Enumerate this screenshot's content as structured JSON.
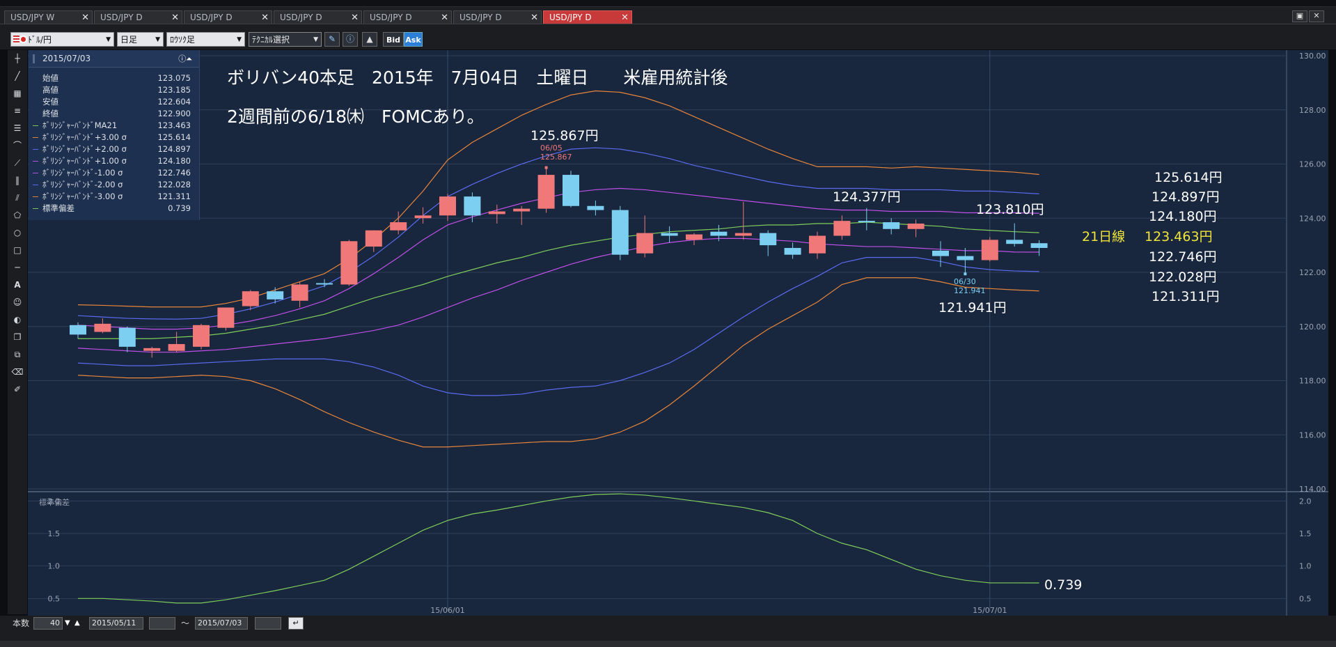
{
  "tabs": [
    {
      "label": "USD/JPY W",
      "active": false
    },
    {
      "label": "USD/JPY D",
      "active": false
    },
    {
      "label": "USD/JPY D",
      "active": false
    },
    {
      "label": "USD/JPY D",
      "active": false
    },
    {
      "label": "USD/JPY D",
      "active": false
    },
    {
      "label": "USD/JPY D",
      "active": false
    },
    {
      "label": "USD/JPY D",
      "active": true
    }
  ],
  "tab_close": "✕",
  "toolbar": {
    "symbol": "ﾄﾞﾙ/円",
    "period": "日足",
    "chart_type": "ﾛｳｿｸ足",
    "technical": "ﾃｸﾆｶﾙ選択",
    "bid": "Bid",
    "ask": "Ask"
  },
  "ohlc_panel": {
    "date": "2015/07/03",
    "rows": [
      {
        "label": "始値",
        "value": "123.075",
        "color": ""
      },
      {
        "label": "高値",
        "value": "123.185",
        "color": ""
      },
      {
        "label": "安値",
        "value": "122.604",
        "color": ""
      },
      {
        "label": "終値",
        "value": "122.900",
        "color": ""
      },
      {
        "label": "ﾎﾞﾘﾝｼﾞｬｰﾊﾞﾝﾄﾞMA21",
        "value": "123.463",
        "color": "#7fcf5a"
      },
      {
        "label": "ﾎﾞﾘﾝｼﾞｬｰﾊﾞﾝﾄﾞ+3.00 σ",
        "value": "125.614",
        "color": "#e8863a"
      },
      {
        "label": "ﾎﾞﾘﾝｼﾞｬｰﾊﾞﾝﾄﾞ+2.00 σ",
        "value": "124.897",
        "color": "#5a6cf0"
      },
      {
        "label": "ﾎﾞﾘﾝｼﾞｬｰﾊﾞﾝﾄﾞ+1.00 σ",
        "value": "124.180",
        "color": "#c050e8"
      },
      {
        "label": "ﾎﾞﾘﾝｼﾞｬｰﾊﾞﾝﾄﾞ-1.00 σ",
        "value": "122.746",
        "color": "#c050e8"
      },
      {
        "label": "ﾎﾞﾘﾝｼﾞｬｰﾊﾞﾝﾄﾞ-2.00 σ",
        "value": "122.028",
        "color": "#5a6cf0"
      },
      {
        "label": "ﾎﾞﾘﾝｼﾞｬｰﾊﾞﾝﾄﾞ-3.00 σ",
        "value": "121.311",
        "color": "#e8863a"
      },
      {
        "label": "標準偏差",
        "value": "0.739",
        "color": "#7fcf5a"
      }
    ]
  },
  "annotations": {
    "title_line1": "ボリバン40本足　2015年　7月04日　土曜日　　米雇用統計後",
    "title_line2": "2週間前の6/18㈭　FOMCあり。",
    "high_label": "125.867円",
    "high_marker_date": "06/05",
    "high_marker_value": "125.867",
    "mid_label": "124.377円",
    "right_label": "123.810円",
    "low_label": "121.941円",
    "low_marker_date": "06/30",
    "low_marker_value": "121.941",
    "band_p3": "125.614円",
    "band_p2": "124.897円",
    "band_p1": "124.180円",
    "ma21_prefix": "21日線",
    "ma21_value": "123.463円",
    "band_m1": "122.746円",
    "band_m2": "122.028円",
    "band_m3": "121.311円",
    "sd_value": "0.739"
  },
  "bottom": {
    "count_label": "本数",
    "count_value": "40",
    "from_date": "2015/05/11",
    "tilde": "～",
    "to_date": "2015/07/03"
  },
  "colors": {
    "bull": "#f07878",
    "bear": "#7ccff0",
    "ma21": "#7fcf5a",
    "sigma1": "#c050e8",
    "sigma2": "#5a6cf0",
    "sigma3": "#e8863a",
    "ma21_label": "#f2e53a"
  },
  "chart_data": [
    {
      "type": "candlestick",
      "title": "",
      "xlabel": "",
      "ylabel": "",
      "ylim": [
        114.0,
        130.0
      ],
      "y_ticks": [
        "130.00",
        "128.00",
        "126.00",
        "124.00",
        "122.00",
        "120.00",
        "118.00",
        "116.00",
        "114.00"
      ],
      "x_ticks": [
        {
          "label": "15/06/01",
          "index": 15
        },
        {
          "label": "15/07/01",
          "index": 37
        }
      ],
      "grid": true,
      "candles": [
        {
          "o": 120.05,
          "h": 120.15,
          "l": 119.55,
          "c": 119.7
        },
        {
          "o": 119.8,
          "h": 120.3,
          "l": 119.75,
          "c": 120.1
        },
        {
          "o": 119.95,
          "h": 120.0,
          "l": 119.05,
          "c": 119.25
        },
        {
          "o": 119.1,
          "h": 119.25,
          "l": 118.85,
          "c": 119.2
        },
        {
          "o": 119.1,
          "h": 119.8,
          "l": 119.05,
          "c": 119.35
        },
        {
          "o": 119.25,
          "h": 120.1,
          "l": 119.15,
          "c": 120.05
        },
        {
          "o": 119.95,
          "h": 120.7,
          "l": 119.85,
          "c": 120.7
        },
        {
          "o": 120.75,
          "h": 121.35,
          "l": 120.6,
          "c": 121.3
        },
        {
          "o": 121.3,
          "h": 121.45,
          "l": 120.85,
          "c": 121.0
        },
        {
          "o": 120.95,
          "h": 121.65,
          "l": 120.7,
          "c": 121.55
        },
        {
          "o": 121.6,
          "h": 121.75,
          "l": 121.45,
          "c": 121.55
        },
        {
          "o": 121.55,
          "h": 123.2,
          "l": 121.5,
          "c": 123.15
        },
        {
          "o": 122.95,
          "h": 123.55,
          "l": 122.75,
          "c": 123.55
        },
        {
          "o": 123.55,
          "h": 124.25,
          "l": 123.4,
          "c": 123.85
        },
        {
          "o": 124.0,
          "h": 124.4,
          "l": 123.8,
          "c": 124.1
        },
        {
          "o": 124.1,
          "h": 124.9,
          "l": 123.9,
          "c": 124.8
        },
        {
          "o": 124.8,
          "h": 124.95,
          "l": 123.85,
          "c": 124.1
        },
        {
          "o": 124.15,
          "h": 124.5,
          "l": 123.8,
          "c": 124.25
        },
        {
          "o": 124.25,
          "h": 124.45,
          "l": 123.75,
          "c": 124.35
        },
        {
          "o": 124.35,
          "h": 125.867,
          "l": 124.2,
          "c": 125.6
        },
        {
          "o": 125.6,
          "h": 125.75,
          "l": 124.4,
          "c": 124.45
        },
        {
          "o": 124.45,
          "h": 124.65,
          "l": 124.1,
          "c": 124.3
        },
        {
          "o": 124.3,
          "h": 124.45,
          "l": 122.45,
          "c": 122.65
        },
        {
          "o": 122.7,
          "h": 124.1,
          "l": 122.55,
          "c": 123.45
        },
        {
          "o": 123.45,
          "h": 123.7,
          "l": 123.1,
          "c": 123.35
        },
        {
          "o": 123.2,
          "h": 123.45,
          "l": 123.0,
          "c": 123.4
        },
        {
          "o": 123.5,
          "h": 123.75,
          "l": 123.15,
          "c": 123.35
        },
        {
          "o": 123.35,
          "h": 124.6,
          "l": 123.2,
          "c": 123.45
        },
        {
          "o": 123.45,
          "h": 123.55,
          "l": 122.6,
          "c": 123.0
        },
        {
          "o": 122.9,
          "h": 123.1,
          "l": 122.5,
          "c": 122.65
        },
        {
          "o": 122.7,
          "h": 123.5,
          "l": 122.5,
          "c": 123.35
        },
        {
          "o": 123.35,
          "h": 124.1,
          "l": 123.2,
          "c": 123.9
        },
        {
          "o": 123.9,
          "h": 124.377,
          "l": 123.55,
          "c": 123.85
        },
        {
          "o": 123.85,
          "h": 124.0,
          "l": 123.4,
          "c": 123.6
        },
        {
          "o": 123.6,
          "h": 123.95,
          "l": 123.3,
          "c": 123.8
        },
        {
          "o": 122.8,
          "h": 123.15,
          "l": 122.2,
          "c": 122.6
        },
        {
          "o": 122.6,
          "h": 122.9,
          "l": 121.941,
          "c": 122.45
        },
        {
          "o": 122.45,
          "h": 123.3,
          "l": 122.4,
          "c": 123.2
        },
        {
          "o": 123.2,
          "h": 123.81,
          "l": 122.95,
          "c": 123.05
        },
        {
          "o": 123.075,
          "h": 123.185,
          "l": 122.604,
          "c": 122.9
        }
      ],
      "bands": {
        "plus3": [
          120.8,
          120.78,
          120.75,
          120.72,
          120.72,
          120.72,
          120.85,
          121.05,
          121.35,
          121.65,
          121.95,
          122.5,
          123.2,
          124.0,
          125.0,
          126.15,
          126.8,
          127.3,
          127.8,
          128.2,
          128.55,
          128.7,
          128.65,
          128.45,
          128.15,
          127.75,
          127.35,
          126.95,
          126.55,
          126.2,
          125.9,
          125.9,
          125.9,
          125.85,
          125.9,
          125.85,
          125.8,
          125.75,
          125.7,
          125.614
        ],
        "plus2": [
          120.4,
          120.35,
          120.3,
          120.28,
          120.27,
          120.3,
          120.45,
          120.65,
          120.9,
          121.2,
          121.5,
          122.0,
          122.6,
          123.3,
          124.1,
          124.8,
          125.25,
          125.65,
          126.0,
          126.3,
          126.55,
          126.6,
          126.55,
          126.4,
          126.2,
          125.95,
          125.75,
          125.55,
          125.35,
          125.2,
          125.1,
          125.1,
          125.1,
          125.05,
          125.05,
          125.05,
          125.0,
          125.0,
          124.95,
          124.897
        ],
        "plus1": [
          120.05,
          120.0,
          119.95,
          119.9,
          119.9,
          119.95,
          120.05,
          120.2,
          120.4,
          120.65,
          120.95,
          121.4,
          121.95,
          122.55,
          123.2,
          123.75,
          124.05,
          124.3,
          124.55,
          124.75,
          124.95,
          125.05,
          125.1,
          125.05,
          124.95,
          124.85,
          124.75,
          124.65,
          124.55,
          124.45,
          124.35,
          124.3,
          124.3,
          124.25,
          124.25,
          124.25,
          124.2,
          124.2,
          124.2,
          124.18
        ],
        "ma21": [
          119.55,
          119.55,
          119.55,
          119.55,
          119.6,
          119.65,
          119.75,
          119.9,
          120.05,
          120.25,
          120.45,
          120.75,
          121.05,
          121.3,
          121.55,
          121.85,
          122.1,
          122.35,
          122.55,
          122.8,
          123.0,
          123.15,
          123.3,
          123.4,
          123.5,
          123.55,
          123.6,
          123.7,
          123.75,
          123.75,
          123.8,
          123.8,
          123.85,
          123.8,
          123.75,
          123.7,
          123.6,
          123.55,
          123.5,
          123.463
        ],
        "minus1": [
          119.2,
          119.15,
          119.1,
          119.05,
          119.05,
          119.1,
          119.15,
          119.25,
          119.35,
          119.45,
          119.55,
          119.7,
          119.85,
          120.05,
          120.35,
          120.7,
          121.05,
          121.35,
          121.7,
          122.0,
          122.3,
          122.55,
          122.75,
          122.95,
          123.1,
          123.2,
          123.25,
          123.25,
          123.2,
          123.15,
          123.05,
          123.0,
          122.95,
          122.95,
          122.9,
          122.85,
          122.8,
          122.8,
          122.75,
          122.746
        ],
        "minus2": [
          118.65,
          118.6,
          118.55,
          118.55,
          118.6,
          118.65,
          118.7,
          118.75,
          118.8,
          118.8,
          118.8,
          118.7,
          118.5,
          118.2,
          117.8,
          117.55,
          117.45,
          117.45,
          117.5,
          117.65,
          117.75,
          117.8,
          118.0,
          118.3,
          118.65,
          119.15,
          119.75,
          120.35,
          120.9,
          121.4,
          121.85,
          122.35,
          122.55,
          122.55,
          122.55,
          122.4,
          122.2,
          122.1,
          122.05,
          122.028
        ],
        "minus3": [
          118.2,
          118.15,
          118.1,
          118.1,
          118.15,
          118.2,
          118.15,
          118.0,
          117.7,
          117.3,
          116.85,
          116.45,
          116.1,
          115.8,
          115.55,
          115.55,
          115.6,
          115.65,
          115.7,
          115.75,
          115.75,
          115.85,
          116.1,
          116.5,
          117.1,
          117.8,
          118.55,
          119.3,
          119.9,
          120.4,
          120.9,
          121.55,
          121.8,
          121.8,
          121.8,
          121.65,
          121.45,
          121.4,
          121.35,
          121.311
        ]
      }
    },
    {
      "type": "line",
      "title": "標準偏差",
      "xlabel": "",
      "ylabel": "",
      "ylim": [
        0.3,
        2.1
      ],
      "y_ticks": [
        "2.0",
        "1.5",
        "1.0",
        "0.5"
      ],
      "grid": true,
      "series": [
        {
          "name": "標準偏差",
          "values": [
            0.5,
            0.5,
            0.48,
            0.46,
            0.43,
            0.43,
            0.48,
            0.55,
            0.62,
            0.7,
            0.78,
            0.95,
            1.15,
            1.35,
            1.55,
            1.7,
            1.8,
            1.86,
            1.93,
            2.0,
            2.06,
            2.1,
            2.11,
            2.09,
            2.05,
            2.0,
            1.95,
            1.9,
            1.82,
            1.7,
            1.5,
            1.35,
            1.25,
            1.1,
            0.95,
            0.85,
            0.78,
            0.74,
            0.74,
            0.739
          ]
        }
      ]
    }
  ]
}
